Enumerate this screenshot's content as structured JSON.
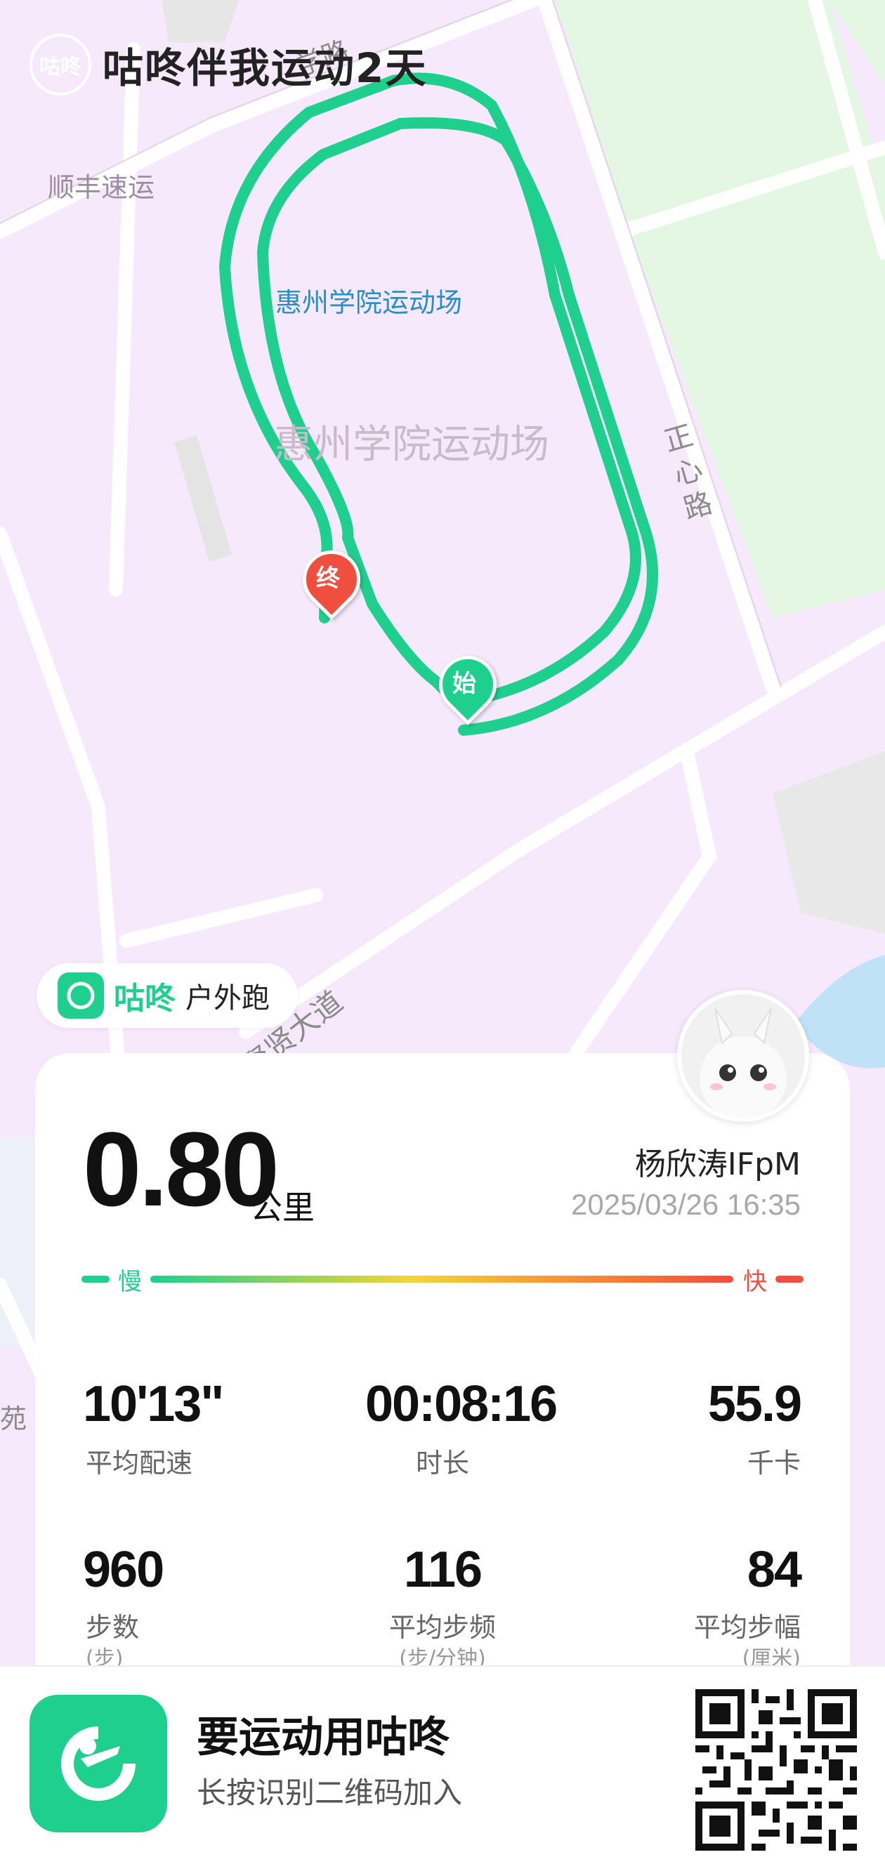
{
  "app": {
    "brand": "咕咚",
    "watermark_title": "咕咚伴我运动2天",
    "accent_color": "#1fcf8e"
  },
  "map": {
    "labels": {
      "shunfeng": "顺丰速运",
      "stadium_blue": "惠州学院运动场",
      "stadium_big": "惠州学院运动场",
      "zhengxin_road": [
        "正",
        "心",
        "路"
      ],
      "road_top": "学路",
      "avenue": "聚贤大道",
      "yuan": "苑"
    },
    "pins": {
      "start": "始",
      "end": "终"
    },
    "route_color": "#1fcf8e"
  },
  "badge": {
    "brand": "咕咚",
    "activity_type": "户外跑"
  },
  "summary": {
    "distance": "0.80",
    "unit": "公里",
    "user_name": "杨欣涛IFpM",
    "datetime": "2025/03/26 16:35",
    "speed_slow": "慢",
    "speed_fast": "快"
  },
  "stats": {
    "pace": {
      "value": "10'13\"",
      "label": "平均配速"
    },
    "duration": {
      "value": "00:08:16",
      "label": "时长"
    },
    "calories": {
      "value": "55.9",
      "label": "千卡"
    },
    "steps": {
      "value": "960",
      "label": "步数",
      "unit": "(步)"
    },
    "cadence": {
      "value": "116",
      "label": "平均步频",
      "unit": "(步/分钟)"
    },
    "stride": {
      "value": "84",
      "label": "平均步幅",
      "unit": "(厘米)"
    }
  },
  "footer": {
    "title": "要运动用咕咚",
    "subtitle": "长按识别二维码加入"
  }
}
